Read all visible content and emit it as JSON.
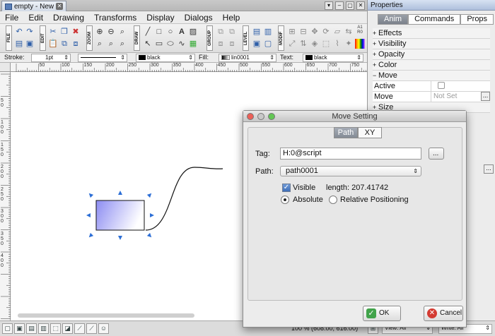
{
  "document_tab": {
    "title": "empty - New"
  },
  "menu": [
    "File",
    "Edit",
    "Drawing",
    "Transforms",
    "Display",
    "Dialogs",
    "Help"
  ],
  "toolbar_groups": [
    "FILE",
    "EDIT",
    "ZOOM",
    "DRAW",
    "GROUP",
    "LEVEL",
    "MODIF"
  ],
  "prop_row": {
    "stroke_label": "Stroke:",
    "stroke_value": "1pt",
    "fill_label": "Fill:",
    "fill_value": "lin0001",
    "text_label": "Text:",
    "text_value": "black",
    "stroke_color": "black"
  },
  "h_ruler_ticks": [
    "50",
    "100",
    "150",
    "200",
    "250",
    "300",
    "350",
    "400",
    "450",
    "500",
    "550",
    "600",
    "650",
    "700",
    "750"
  ],
  "v_ruler_ticks": [
    "50",
    "100",
    "150",
    "200",
    "250",
    "300",
    "350",
    "400"
  ],
  "statusbar": {
    "coords": "100 % (608.00, 616.00)",
    "view_label": "View: All",
    "write_label": "Write: All"
  },
  "properties": {
    "title": "Properties",
    "tabs": [
      "Anim",
      "Commands",
      "Props"
    ],
    "rows": [
      {
        "sign": "+",
        "label": "Effects"
      },
      {
        "sign": "+",
        "label": "Visibility"
      },
      {
        "sign": "+",
        "label": "Opacity"
      },
      {
        "sign": "+",
        "label": "Color"
      },
      {
        "sign": "−",
        "label": "Move"
      }
    ],
    "active_label": "Active",
    "move_label": "Move",
    "move_value": "Not Set",
    "size_row": {
      "sign": "+",
      "label": "Size"
    }
  },
  "dialog": {
    "title": "Move Setting",
    "tabs": [
      "Path",
      "XY"
    ],
    "tag_label": "Tag:",
    "tag_value": "H:0@script",
    "browse_label": "...",
    "path_label": "Path:",
    "path_value": "path0001",
    "visible_label": "Visible",
    "length_text": "length: 207.41742",
    "absolute_label": "Absolute",
    "relative_label": "Relative Positioning",
    "ok_label": "OK",
    "cancel_label": "Cancel"
  },
  "colors": {
    "selection_handles": "#2d6fd6",
    "rect_gradient_start": "#8c8cf2",
    "rect_gradient_end": "#ffffff"
  }
}
